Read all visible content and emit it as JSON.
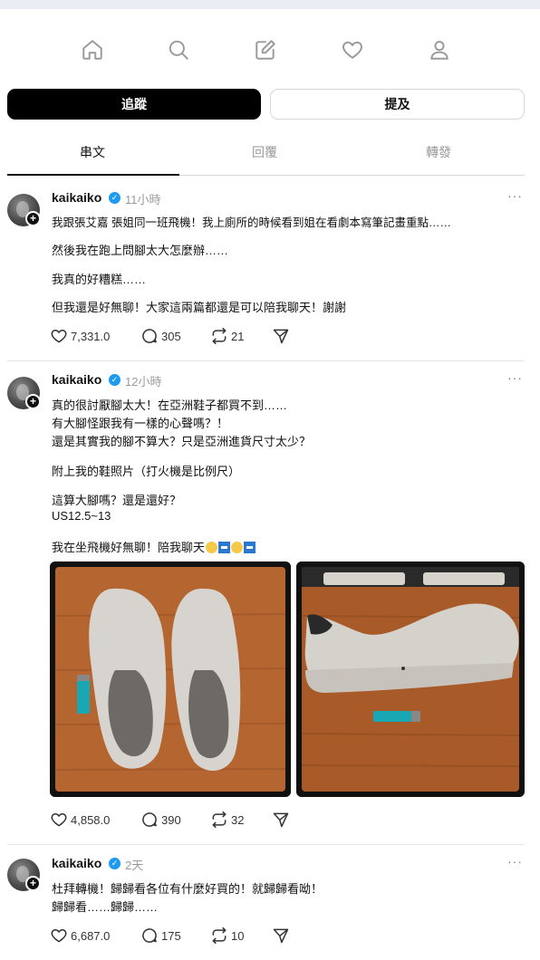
{
  "nav": {
    "icons": [
      "home-icon",
      "search-icon",
      "compose-icon",
      "heart-icon",
      "profile-icon"
    ]
  },
  "buttons": {
    "follow_label": "追蹤",
    "mention_label": "提及"
  },
  "tabs": [
    {
      "label": "串文",
      "active": true
    },
    {
      "label": "回覆",
      "active": false
    },
    {
      "label": "轉發",
      "active": false
    }
  ],
  "posts": [
    {
      "username": "kaikaiko",
      "time": "11小時",
      "lines": [
        "我跟張艾嘉 張姐同一班飛機！我上廁所的時候看到姐在看劇本寫筆記畫重點……",
        "然後我在跑上問腳太大怎麼辦……",
        "我真的好糟糕……",
        "但我還是好無聊！大家這兩篇都還是可以陪我聊天！謝謝"
      ],
      "likes": "7,331.0",
      "comments": "305",
      "reposts": "21"
    },
    {
      "username": "kaikaiko",
      "time": "12小時",
      "lines": [
        "真的很討厭腳太大！在亞洲鞋子都買不到……",
        "有大腳怪跟我有一樣的心聲嗎？！",
        "還是其實我的腳不算大？只是亞洲進貨尺寸太少？",
        "附上我的鞋照片（打火機是比例尺）",
        "這算大腳嗎？還是還好？",
        "US12.5~13",
        "我在坐飛機好無聊！陪我聊天"
      ],
      "likes": "4,858.0",
      "comments": "390",
      "reposts": "32"
    },
    {
      "username": "kaikaiko",
      "time": "2天",
      "lines": [
        "杜拜轉機！歸歸看各位有什麼好買的！就歸歸看呦！",
        "歸歸看……歸歸……"
      ],
      "likes": "6,687.0",
      "comments": "175",
      "reposts": "10"
    }
  ],
  "colors": {
    "accent": "#000000",
    "verified": "#1d9bf0",
    "muted": "#9a9a9a"
  }
}
